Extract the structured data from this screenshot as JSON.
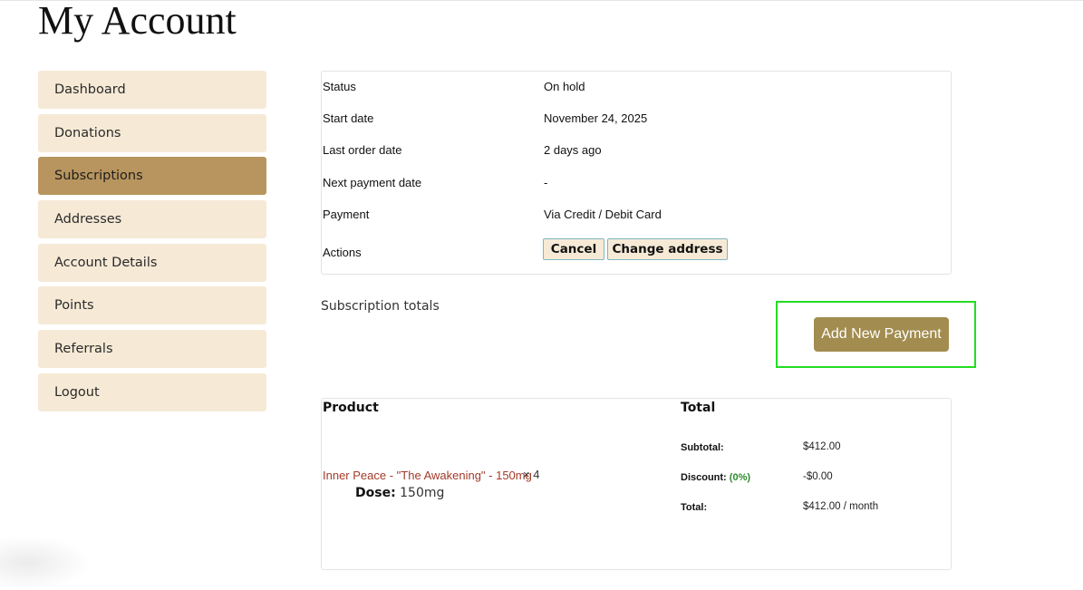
{
  "page": {
    "title": "My Account"
  },
  "sidebar": {
    "items": [
      {
        "label": "Dashboard"
      },
      {
        "label": "Donations"
      },
      {
        "label": "Subscriptions",
        "active": true
      },
      {
        "label": "Addresses"
      },
      {
        "label": "Account Details"
      },
      {
        "label": "Points"
      },
      {
        "label": "Referrals"
      },
      {
        "label": "Logout"
      }
    ]
  },
  "subscription": {
    "status": {
      "label": "Status",
      "value": "On hold"
    },
    "start_date": {
      "label": "Start date",
      "value": "November 24, 2025"
    },
    "last_order_date": {
      "label": "Last order date",
      "value": "2 days ago"
    },
    "next_payment_date": {
      "label": "Next payment date",
      "value": "-"
    },
    "payment": {
      "label": "Payment",
      "value": "Via Credit / Debit Card"
    },
    "actions": {
      "label": "Actions",
      "cancel": "Cancel",
      "change_address": "Change address"
    }
  },
  "totals": {
    "heading": "Subscription totals",
    "add_payment": "Add New Payment"
  },
  "order": {
    "col_product": "Product",
    "col_total": "Total",
    "product_name": "Inner Peace - \"The Awakening\" - 150mg",
    "quantity": "× 4",
    "dose_label": "Dose:",
    "dose_value": "150mg",
    "subtotal_label": "Subtotal:",
    "subtotal_value": "$412.00",
    "discount_label": "Discount:",
    "discount_pct": "(0%)",
    "discount_value": "-$0.00",
    "total_label": "Total:",
    "total_value": "$412.00 / month"
  },
  "colors": {
    "nav_bg": "#f6ead6",
    "nav_active": "#b8955e",
    "accent_button": "#a28c4f",
    "highlight": "#22dd22",
    "link": "#a33a2a"
  }
}
